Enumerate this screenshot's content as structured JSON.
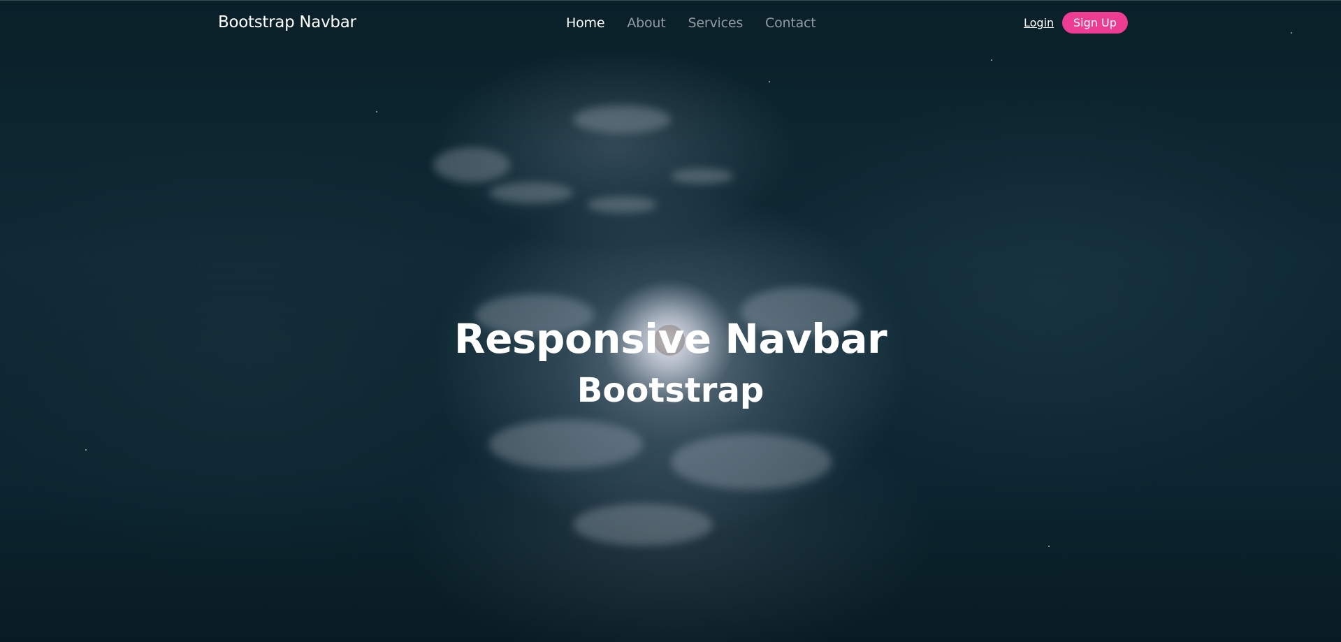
{
  "navbar": {
    "brand": "Bootstrap Navbar",
    "links": [
      {
        "label": "Home",
        "active": true
      },
      {
        "label": "About",
        "active": false
      },
      {
        "label": "Services",
        "active": false
      },
      {
        "label": "Contact",
        "active": false
      }
    ],
    "login_label": "Login",
    "signup_label": "Sign Up"
  },
  "hero": {
    "title": "Responsive Navbar",
    "subtitle": "Bootstrap"
  },
  "colors": {
    "accent": "#ec3d93",
    "background": "#0f2a35",
    "text": "#ffffff"
  }
}
